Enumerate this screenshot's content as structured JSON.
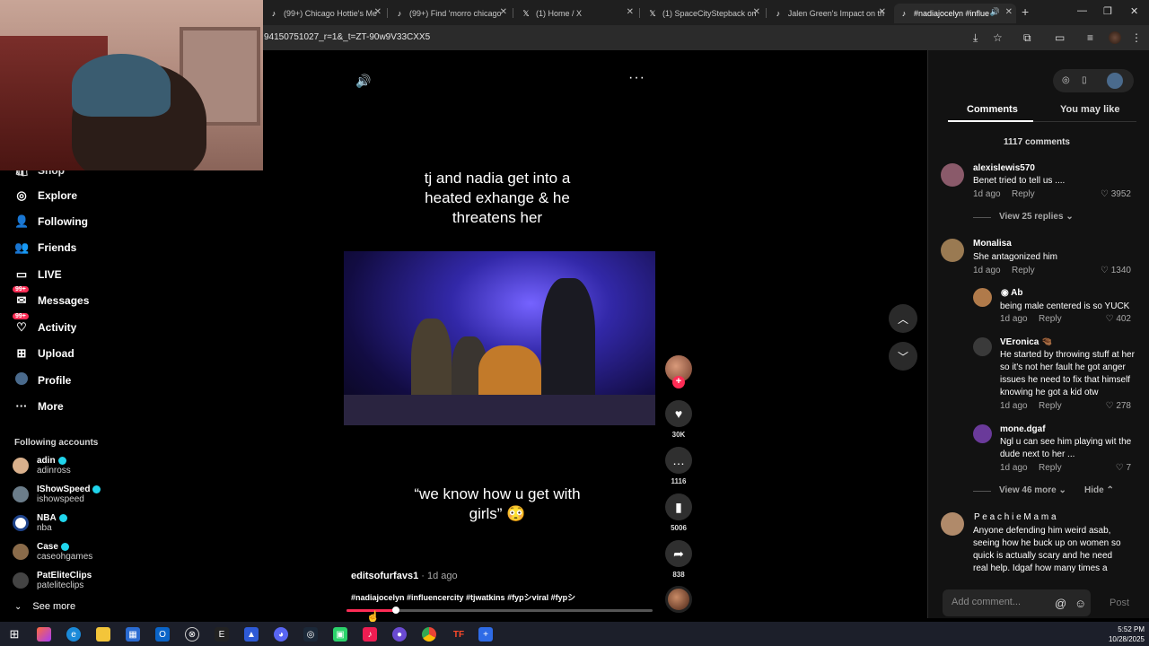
{
  "browser": {
    "tabs": [
      {
        "label": "(99+) Chicago Hottie's Me",
        "icon": "tiktok-icon"
      },
      {
        "label": "(99+) Find 'morro chicago",
        "icon": "tiktok-icon"
      },
      {
        "label": "(1) Home / X",
        "icon": "x-icon"
      },
      {
        "label": "(1) SpaceCityStepback on",
        "icon": "x-icon"
      },
      {
        "label": "Jalen Green's Impact on th",
        "icon": "tiktok-icon"
      },
      {
        "label": "#nadiajocelyn #influe",
        "icon": "tiktok-icon"
      }
    ],
    "url": "94150751027_r=1&_t=ZT-90w9V33CXX5"
  },
  "sidebar": {
    "partial_item": "Shop",
    "items": [
      {
        "label": "Explore",
        "icon": "compass-icon"
      },
      {
        "label": "Following",
        "icon": "following-icon"
      },
      {
        "label": "Friends",
        "icon": "friends-icon"
      },
      {
        "label": "LIVE",
        "icon": "live-icon"
      },
      {
        "label": "Messages",
        "icon": "messages-icon",
        "badge": "99+"
      },
      {
        "label": "Activity",
        "icon": "activity-icon",
        "badge": "99+"
      },
      {
        "label": "Upload",
        "icon": "upload-icon"
      },
      {
        "label": "Profile",
        "icon": "profile-icon"
      },
      {
        "label": "More",
        "icon": "more-icon"
      }
    ],
    "following_header": "Following accounts",
    "accounts": [
      {
        "name": "adin",
        "handle": "adinross",
        "verified": true
      },
      {
        "name": "IShowSpeed",
        "handle": "ishowspeed",
        "verified": true
      },
      {
        "name": "NBA",
        "handle": "nba",
        "verified": true
      },
      {
        "name": "Case",
        "handle": "caseohgames",
        "verified": true
      },
      {
        "name": "PatEliteClips",
        "handle": "pateliteclips",
        "verified": false
      }
    ],
    "see_more": "See more"
  },
  "video": {
    "caption_top": "tj and nadia get into a heated exhange & he threatens her",
    "caption_top_lines": [
      "tj and nadia get into a",
      "heated exhange & he",
      "threatens her"
    ],
    "caption_bottom_lines": [
      "“we know how u get with",
      "girls” 😳"
    ],
    "author": "editsofurfavs1",
    "posted": "1d ago",
    "hashtags": "#nadiajocelyn #influencercity #tjwatkins #fypシviral #fypシ",
    "progress": 0.16
  },
  "actions": {
    "likes": "30K",
    "comments": "1116",
    "saves": "5006",
    "shares": "838"
  },
  "comments_panel": {
    "tab_comments": "Comments",
    "tab_you_may_like": "You may like",
    "count": "1117 comments",
    "comments": [
      {
        "user": "alexislewis570",
        "text": "Benet tried to tell us ....",
        "time": "1d ago",
        "reply": "Reply",
        "likes": "3952"
      },
      {
        "user": "Monalisa",
        "text": "She antagonized him",
        "time": "1d ago",
        "reply": "Reply",
        "likes": "1340"
      },
      {
        "user": "Ab",
        "text": "being male centered is so YUCK",
        "time": "1d ago",
        "reply": "Reply",
        "likes": "402"
      },
      {
        "user": "VEronica",
        "text": "He started by throwing stuff at her so it's not her fault he got anger issues he need to fix that himself knowing he got a kid otw",
        "time": "1d ago",
        "reply": "Reply",
        "likes": "278"
      },
      {
        "user": "mone.dgaf",
        "text": "Ngl u can see him playing wit the dude next to her ...",
        "time": "1d ago",
        "reply": "Reply",
        "likes": "7"
      },
      {
        "user": "P e a c h i e M a m a",
        "text": "Anyone defending him weird asab, seeing how he buck up on women so quick is actually scary and he need real help. Idgaf how many times a female",
        "time": "",
        "reply": "",
        "likes": ""
      }
    ],
    "view_replies_1": "View 25 replies",
    "view_more": "View 46 more",
    "hide": "Hide",
    "add_placeholder": "Add comment...",
    "post": "Post"
  },
  "taskbar": {
    "time": "5:52 PM",
    "date": "10/28/2025"
  },
  "colors": {
    "accent": "#fe2c55",
    "verified": "#20d5ec",
    "panel_bg": "#121212"
  }
}
